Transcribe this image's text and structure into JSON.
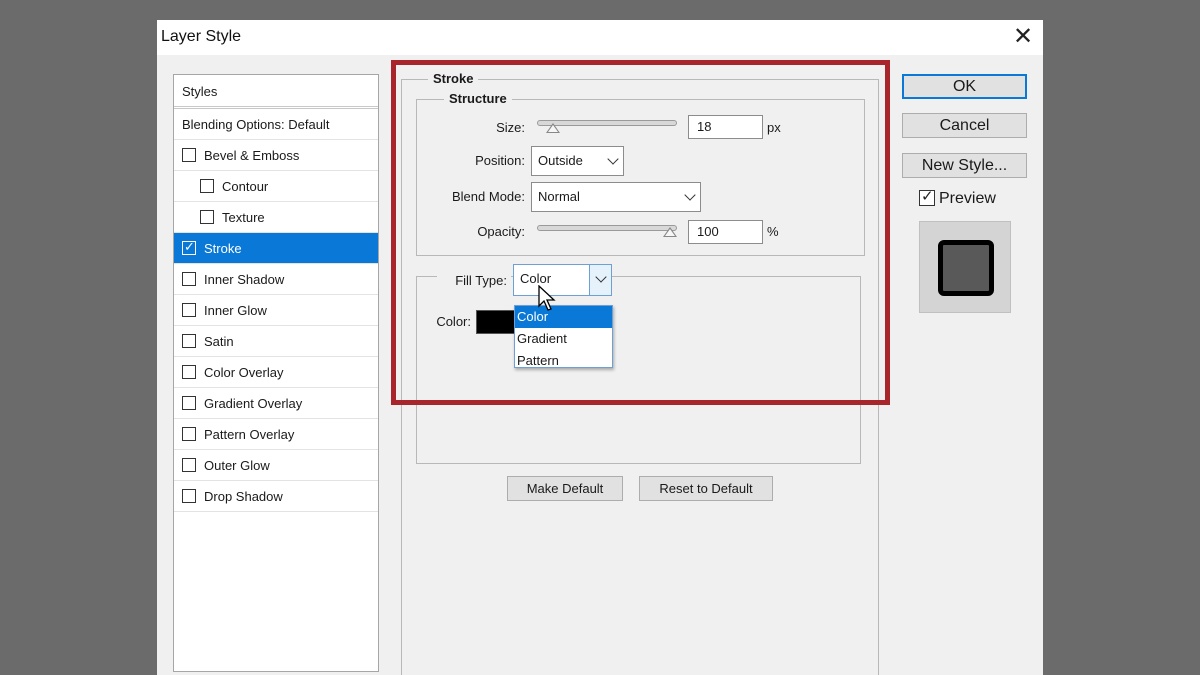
{
  "window": {
    "title": "Layer Style",
    "close_glyph": "✕"
  },
  "styles": {
    "header": "Styles",
    "blending": "Blending Options: Default",
    "items": [
      {
        "label": "Bevel & Emboss",
        "checked": false,
        "sub": false
      },
      {
        "label": "Contour",
        "checked": false,
        "sub": true
      },
      {
        "label": "Texture",
        "checked": false,
        "sub": true
      },
      {
        "label": "Stroke",
        "checked": true,
        "sub": false,
        "selected": true
      },
      {
        "label": "Inner Shadow",
        "checked": false,
        "sub": false
      },
      {
        "label": "Inner Glow",
        "checked": false,
        "sub": false
      },
      {
        "label": "Satin",
        "checked": false,
        "sub": false
      },
      {
        "label": "Color Overlay",
        "checked": false,
        "sub": false
      },
      {
        "label": "Gradient Overlay",
        "checked": false,
        "sub": false
      },
      {
        "label": "Pattern Overlay",
        "checked": false,
        "sub": false
      },
      {
        "label": "Outer Glow",
        "checked": false,
        "sub": false
      },
      {
        "label": "Drop Shadow",
        "checked": false,
        "sub": false
      }
    ]
  },
  "stroke": {
    "section_title": "Stroke",
    "structure_title": "Structure",
    "size_label": "Size:",
    "size_value": "18",
    "size_unit": "px",
    "size_slider_fraction": 0.07,
    "position_label": "Position:",
    "position_value": "Outside",
    "blend_label": "Blend Mode:",
    "blend_value": "Normal",
    "opacity_label": "Opacity:",
    "opacity_value": "100",
    "opacity_unit": "%",
    "opacity_slider_fraction": 1.0,
    "fill_type_label": "Fill Type:",
    "fill_type_value": "Color",
    "fill_type_options": [
      "Color",
      "Gradient",
      "Pattern"
    ],
    "color_label": "Color:",
    "color_swatch": "#000000",
    "make_default": "Make Default",
    "reset_default": "Reset to Default"
  },
  "actions": {
    "ok": "OK",
    "cancel": "Cancel",
    "new_style": "New Style...",
    "preview_label": "Preview",
    "preview_checked": true
  },
  "colors": {
    "accent": "#0a78d7",
    "highlight_box": "#a8262b",
    "preview_fill": "#595959",
    "preview_stroke": "#000000"
  }
}
